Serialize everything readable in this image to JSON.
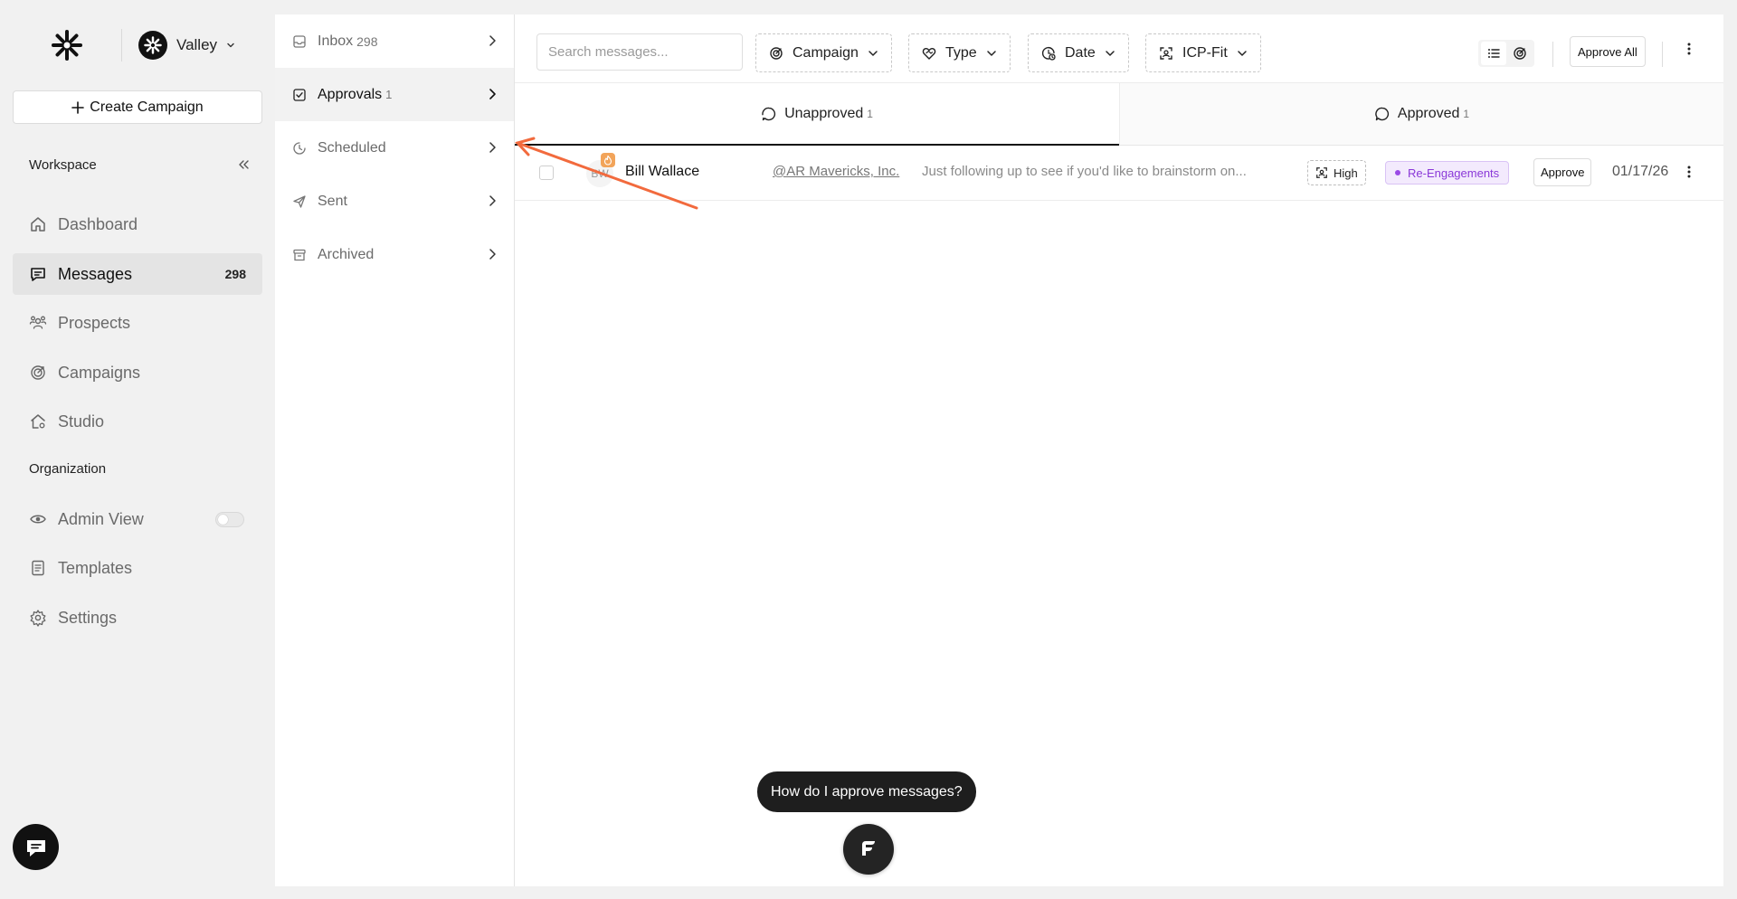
{
  "workspace": {
    "name": "Valley"
  },
  "sidebar": {
    "create_label": "Create Campaign",
    "workspace_section": "Workspace",
    "organization_section": "Organization",
    "nav": {
      "dashboard": "Dashboard",
      "messages": "Messages",
      "messages_count": "298",
      "prospects": "Prospects",
      "campaigns": "Campaigns",
      "studio": "Studio",
      "admin_view": "Admin View",
      "templates": "Templates",
      "settings": "Settings"
    },
    "admin_view_enabled": false
  },
  "folders": {
    "inbox": {
      "label": "Inbox",
      "count": "298"
    },
    "approvals": {
      "label": "Approvals",
      "count": "1"
    },
    "scheduled": {
      "label": "Scheduled"
    },
    "sent": {
      "label": "Sent"
    },
    "archived": {
      "label": "Archived"
    }
  },
  "toolbar": {
    "search_placeholder": "Search messages...",
    "filters": {
      "campaign": "Campaign",
      "type": "Type",
      "date": "Date",
      "icp": "ICP-Fit"
    },
    "approve_all": "Approve All"
  },
  "tabs": {
    "unapproved": {
      "label": "Unapproved",
      "count": "1"
    },
    "approved": {
      "label": "Approved",
      "count": "1"
    }
  },
  "messages": [
    {
      "initials": "BW",
      "name": "Bill Wallace",
      "company": "@AR Mavericks, Inc.",
      "snippet": "Just following up to see if you'd like to brainstorm on...",
      "icp_fit": "High",
      "campaign": "Re-Engagements",
      "action": "Approve",
      "date": "01/17/26"
    }
  ],
  "assistant": {
    "hint": "How do I approve messages?"
  },
  "colors": {
    "annotation_arrow": "#f26a3d",
    "campaign_chip": "#8a38d8",
    "avatar_badge": "#f2a45a"
  }
}
